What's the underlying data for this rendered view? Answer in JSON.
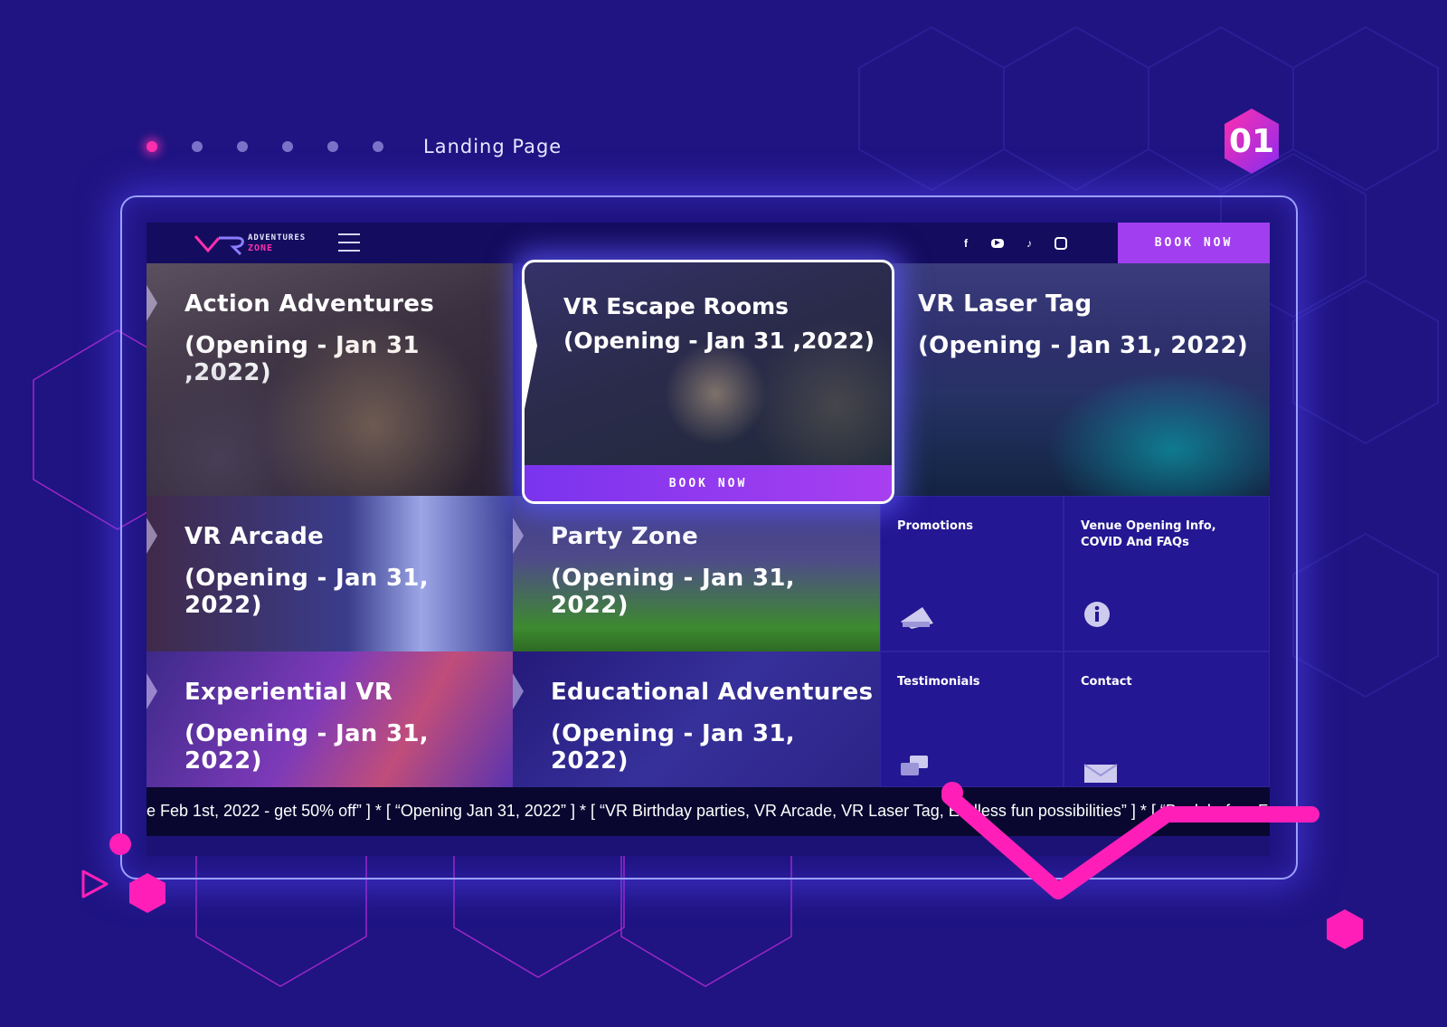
{
  "pager": {
    "label": "Landing Page",
    "dots": 6,
    "active_index": 0
  },
  "badge": {
    "number": "01"
  },
  "topbar": {
    "logo_line1": "ADVENTURES",
    "logo_line2": "ZONE",
    "social_icons": [
      "facebook-icon",
      "youtube-icon",
      "tiktok-icon",
      "instagram-icon"
    ],
    "book_label": "BOOK NOW"
  },
  "tiles": {
    "action": {
      "title": "Action Adventures",
      "subtitle": "(Opening - Jan 31 ,2022)"
    },
    "escape": {
      "title": "VR Escape Rooms",
      "subtitle": "(Opening - Jan 31 ,2022)",
      "button": "BOOK NOW"
    },
    "laser": {
      "title": "VR Laser Tag",
      "subtitle": "(Opening - Jan 31, 2022)"
    },
    "arcade": {
      "title": "VR Arcade",
      "subtitle": "(Opening - Jan 31, 2022)"
    },
    "party": {
      "title": "Party Zone",
      "subtitle": "(Opening - Jan 31, 2022)"
    },
    "experiential": {
      "title": "Experiential VR",
      "subtitle": "(Opening - Jan 31, 2022)"
    },
    "educational": {
      "title": "Educational Adventures",
      "subtitle": "(Opening - Jan 31, 2022)"
    }
  },
  "info": {
    "promotions": "Promotions",
    "venue_line1": "Venue Opening Info,",
    "venue_line2": "COVID And FAQs",
    "testimonials": "Testimonials",
    "contact": "Contact"
  },
  "ticker": {
    "text": "e Feb 1st, 2022 - get 50% off” ] * [ “Opening Jan 31, 2022” ] * [ “VR Birthday parties, VR Arcade, VR Laser Tag, Endless fun possibilities” ] * [ “Book before F"
  },
  "colors": {
    "background": "#1f1482",
    "accent_pink": "#ff2fae",
    "accent_purple": "#a13ff0",
    "frame_glow": "#5546ff"
  }
}
